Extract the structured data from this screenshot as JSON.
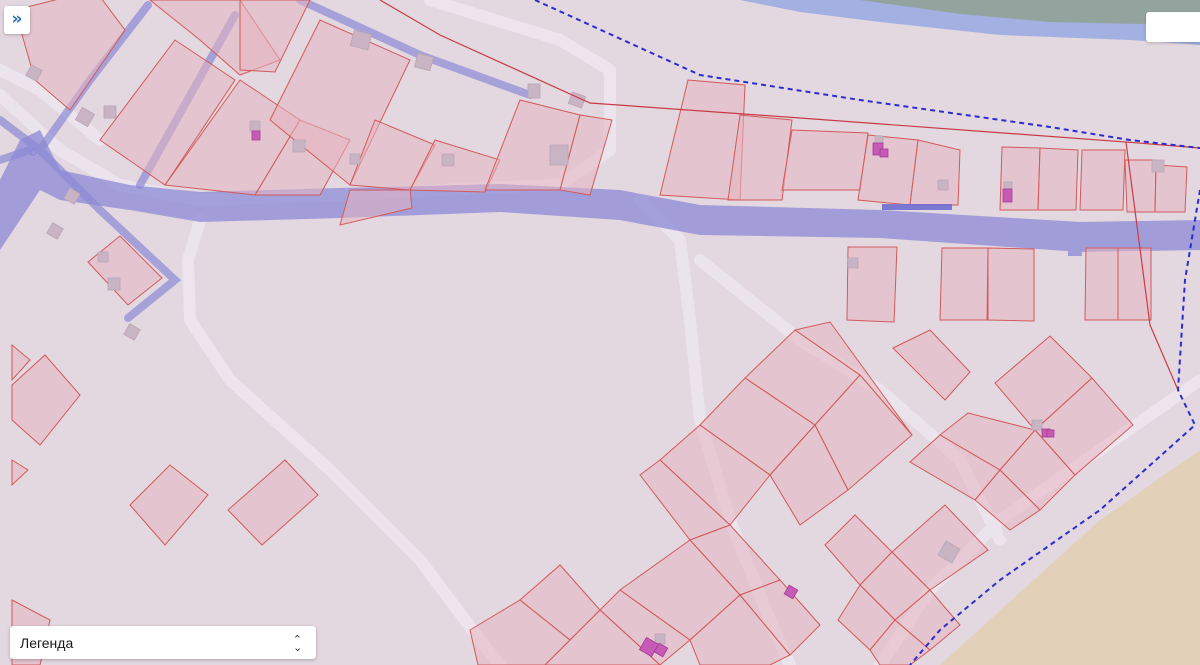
{
  "map": {
    "colors": {
      "background": "#e3d7e0",
      "water": "#a3b1e2",
      "sea": "#93a39e",
      "sand": "#e3d0b8",
      "parcel_fill": "#e6b4c1",
      "parcel_stroke": "#d25a5a",
      "road": "#ede6ee",
      "river": "#8c8ad6",
      "building": "#c9b4c4",
      "building_magenta": "#c65ab4",
      "boundary_dashed": "#2c2cd0",
      "boundary_red": "#c83c46"
    }
  },
  "controls": {
    "expand_icon": "»",
    "legend_label": "Легенда",
    "legend_chevron_icon": "chevron-up-down-icon"
  }
}
